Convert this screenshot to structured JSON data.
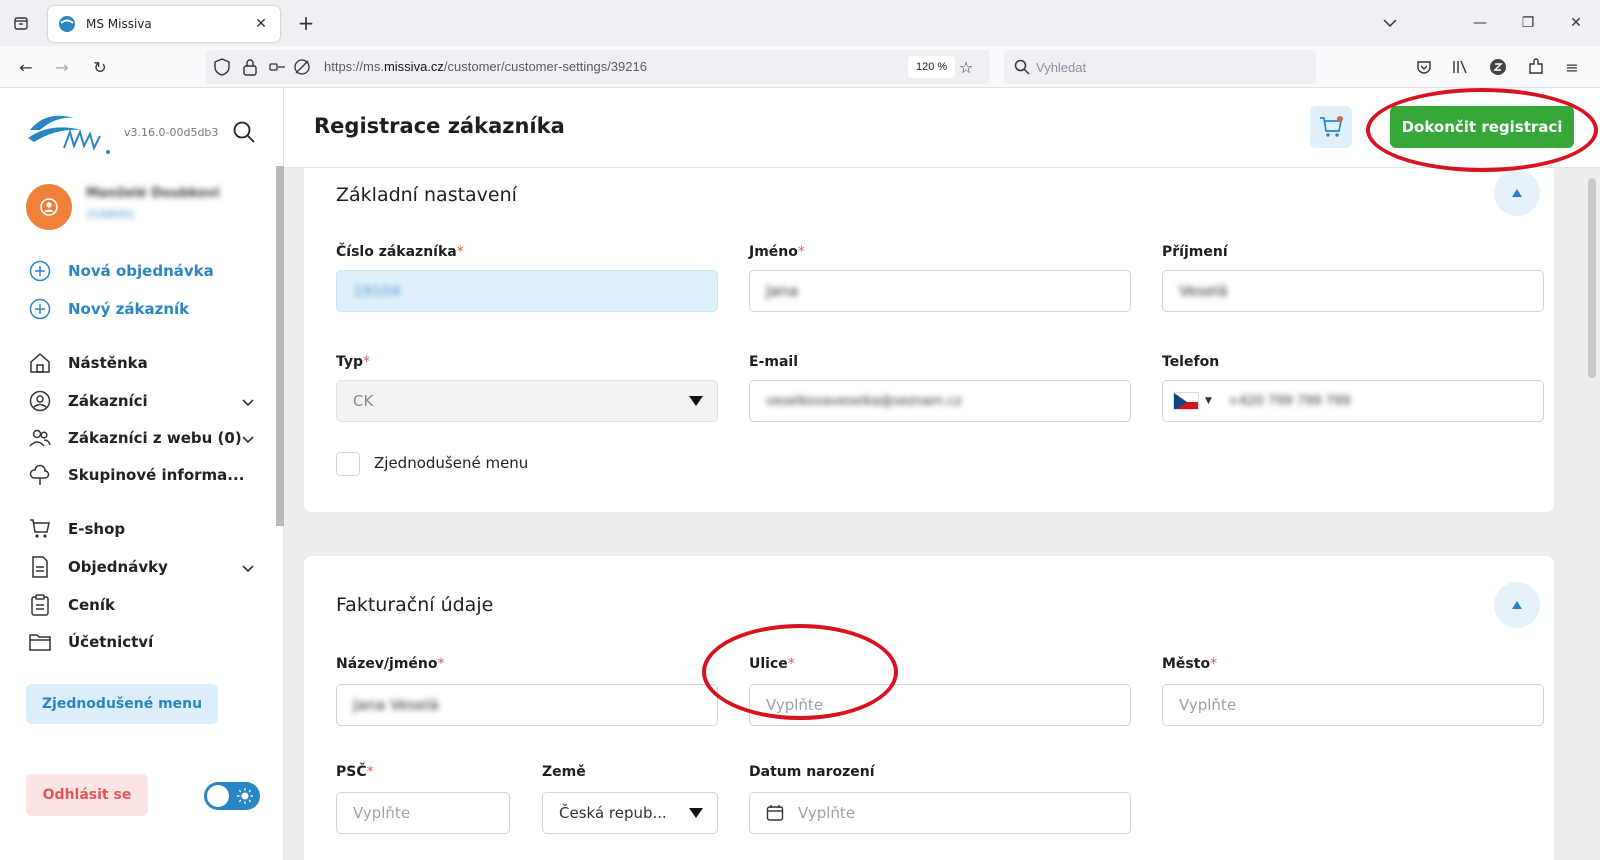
{
  "browser": {
    "tab_title": "MS Missiva",
    "url_prefix": "https://ms.",
    "url_domain": "missiva.cz",
    "url_path": "/customer/customer-settings/39216",
    "zoom": "120 %",
    "search_placeholder": "Vyhledat"
  },
  "sidebar": {
    "version": "v3.16.0-00d5db3",
    "user_name": "Manželé Doubkovi",
    "user_id": "3198001",
    "actions": [
      {
        "label": "Nová objednávka"
      },
      {
        "label": "Nový zákazník"
      }
    ],
    "items": [
      {
        "label": "Nástěnka"
      },
      {
        "label": "Zákazníci"
      },
      {
        "label": "Zákazníci z webu (0)"
      },
      {
        "label": "Skupinové informa..."
      },
      {
        "label": "E-shop"
      },
      {
        "label": "Objednávky"
      },
      {
        "label": "Ceník"
      },
      {
        "label": "Účetnictví"
      }
    ],
    "simple_menu_label": "Zjednodušené menu",
    "logout_label": "Odhlásit se"
  },
  "header": {
    "title": "Registrace zákazníka",
    "finish_label": "Dokončit registraci"
  },
  "basic": {
    "title": "Základní nastavení",
    "customer_number": {
      "label": "Číslo zákazníka",
      "value": "19104"
    },
    "first_name": {
      "label": "Jméno",
      "value": "Jana"
    },
    "last_name": {
      "label": "Příjmení",
      "value": "Veselá"
    },
    "type": {
      "label": "Typ",
      "value": "CK"
    },
    "email": {
      "label": "E-mail",
      "value": "veselkovaveselka@seznam.cz"
    },
    "phone": {
      "label": "Telefon",
      "value": "+420 799 799 799"
    },
    "simple_menu": {
      "label": "Zjednodušené menu"
    }
  },
  "billing": {
    "title": "Fakturační údaje",
    "name": {
      "label": "Název/jméno",
      "value": "Jana Veselá"
    },
    "street": {
      "label": "Ulice",
      "placeholder": "Vyplňte"
    },
    "city": {
      "label": "Město",
      "placeholder": "Vyplňte"
    },
    "zip": {
      "label": "PSČ",
      "placeholder": "Vyplňte"
    },
    "country": {
      "label": "Země",
      "value": "Česká repub..."
    },
    "birth_date": {
      "label": "Datum narození",
      "placeholder": "Vyplňte"
    }
  },
  "colors": {
    "accent": "#2a86c2",
    "success": "#36a83a",
    "danger": "#e25757",
    "highlight": "#d9121f"
  }
}
